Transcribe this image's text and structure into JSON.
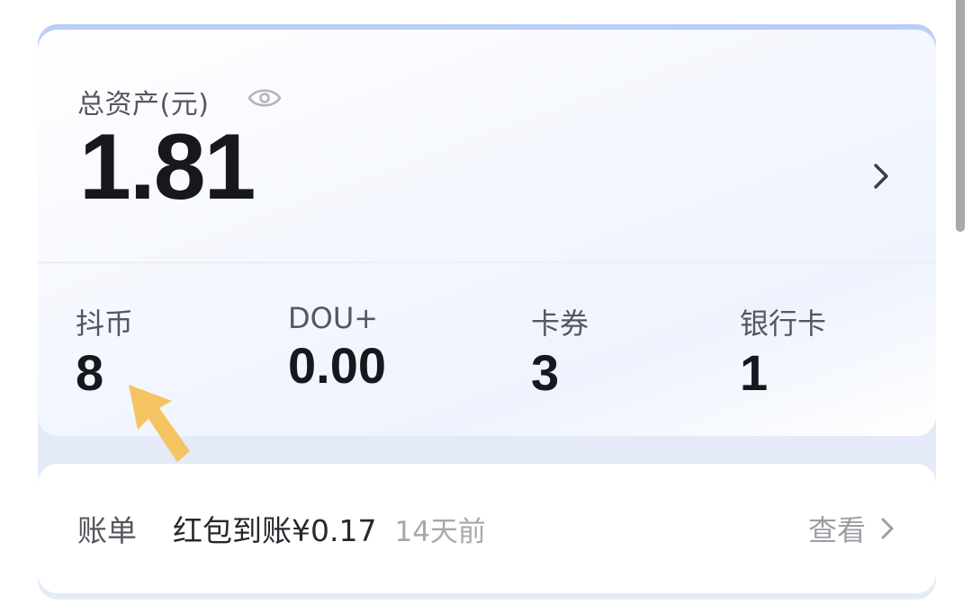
{
  "assets": {
    "total_label": "总资产(元)",
    "total_value": "1.81",
    "stats": [
      {
        "label": "抖币",
        "value": "8"
      },
      {
        "label": "DOU+",
        "value": "0.00"
      },
      {
        "label": "卡券",
        "value": "3"
      },
      {
        "label": "银行卡",
        "value": "1"
      }
    ]
  },
  "bill": {
    "label": "账单",
    "description": "红包到账¥0.17",
    "time": "14天前",
    "view_label": "查看"
  },
  "icons": {
    "visibility": "eye-icon",
    "detail": "chevron-right-icon",
    "annotation": "arrow-up-left-icon"
  },
  "colors": {
    "accent_band": "#c4d4f6",
    "annotation_arrow": "#f5c462",
    "primary_text": "#16181d",
    "secondary_text": "#55575d",
    "muted_text": "#a6a8ae"
  }
}
